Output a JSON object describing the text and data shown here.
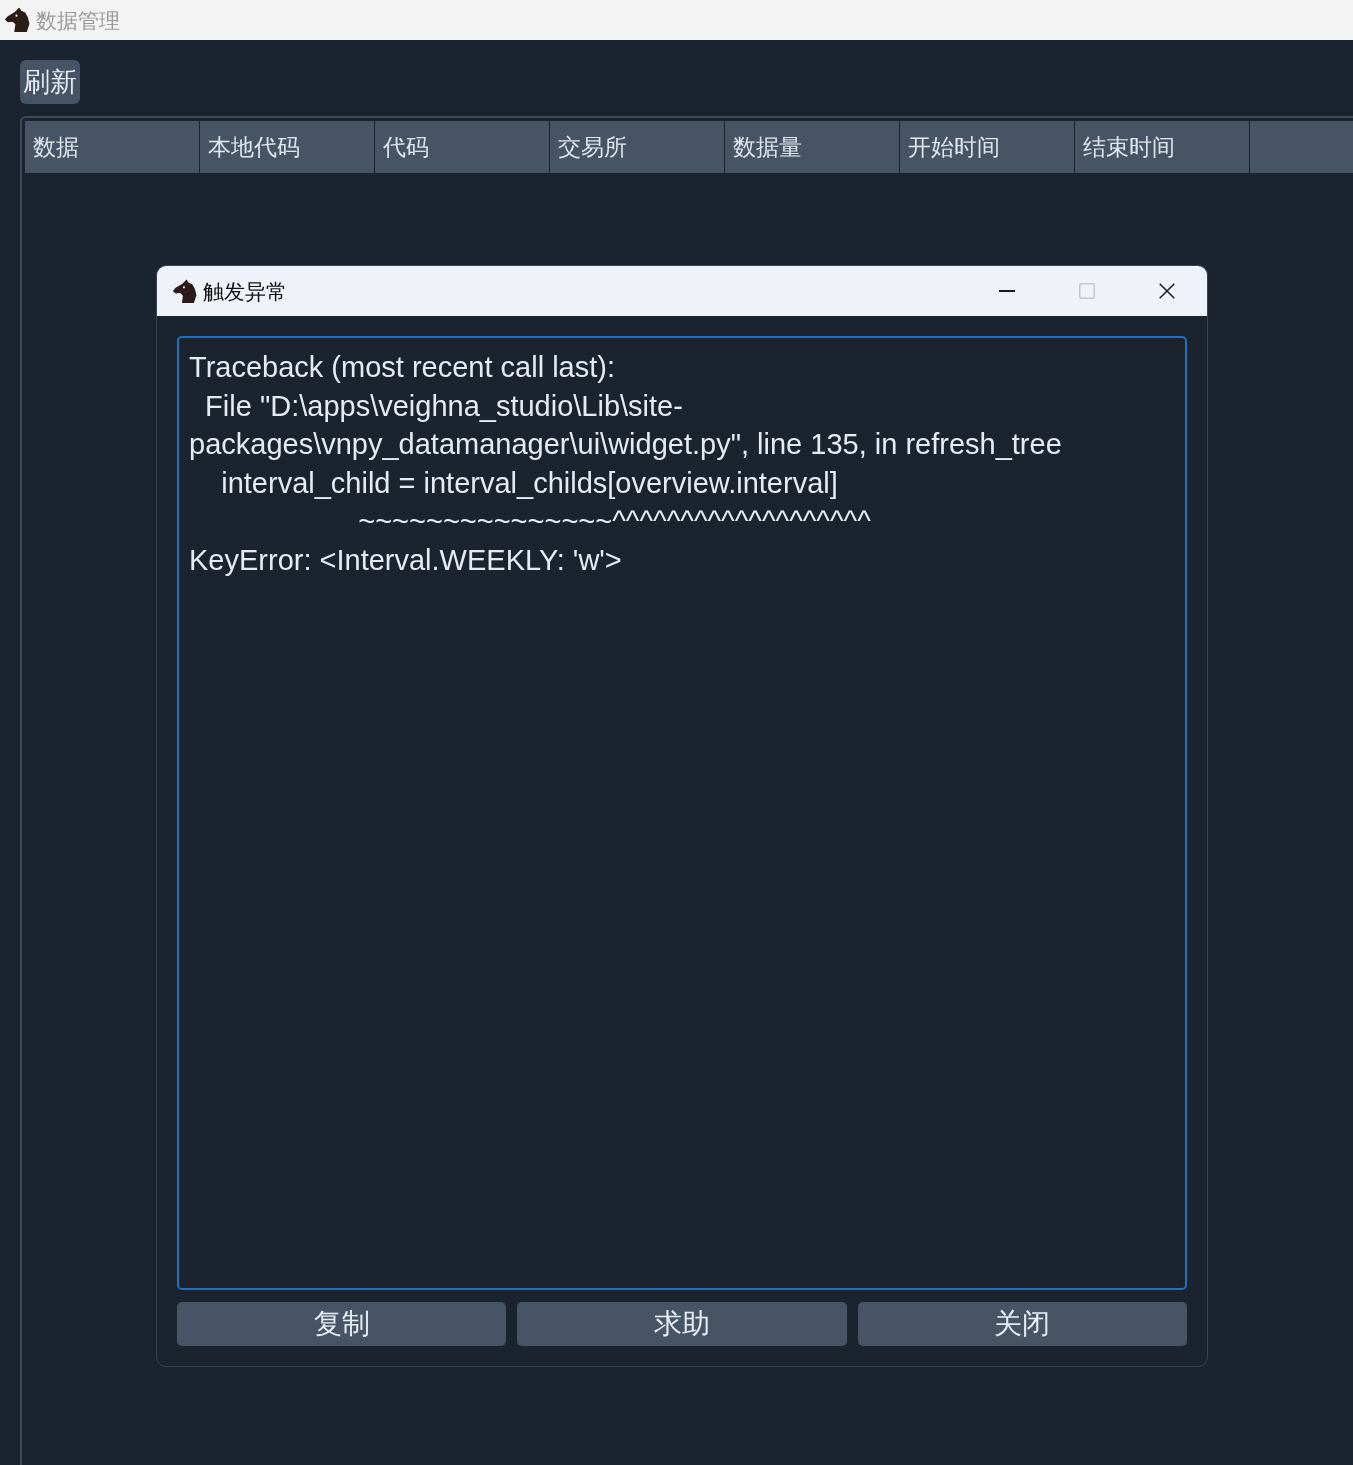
{
  "window": {
    "title": "数据管理"
  },
  "toolbar": {
    "refresh_button": "刷新"
  },
  "table": {
    "columns": [
      "数据",
      "本地代码",
      "代码",
      "交易所",
      "数据量",
      "开始时间",
      "结束时间"
    ]
  },
  "dialog": {
    "title": "触发异常",
    "controls": [
      {
        "kind": "minimize",
        "disabled": false
      },
      {
        "kind": "maximize",
        "disabled": true
      },
      {
        "kind": "close",
        "disabled": false
      }
    ],
    "traceback": {
      "focused": true,
      "lines": [
        "Traceback (most recent call last):",
        "  File \"D:\\apps\\veighna_studio\\Lib\\site-",
        "packages\\vnpy_datamanager\\ui\\widget.py\", line 135, in refresh_tree",
        "    interval_child = interval_childs[overview.interval]",
        "                     ~~~~~~~~~~~~~~~^^^^^^^^^^^^^^^^^^^",
        "KeyError: <Interval.WEEKLY: 'w'>"
      ]
    },
    "buttons": [
      "复制",
      "求助",
      "关闭"
    ]
  }
}
